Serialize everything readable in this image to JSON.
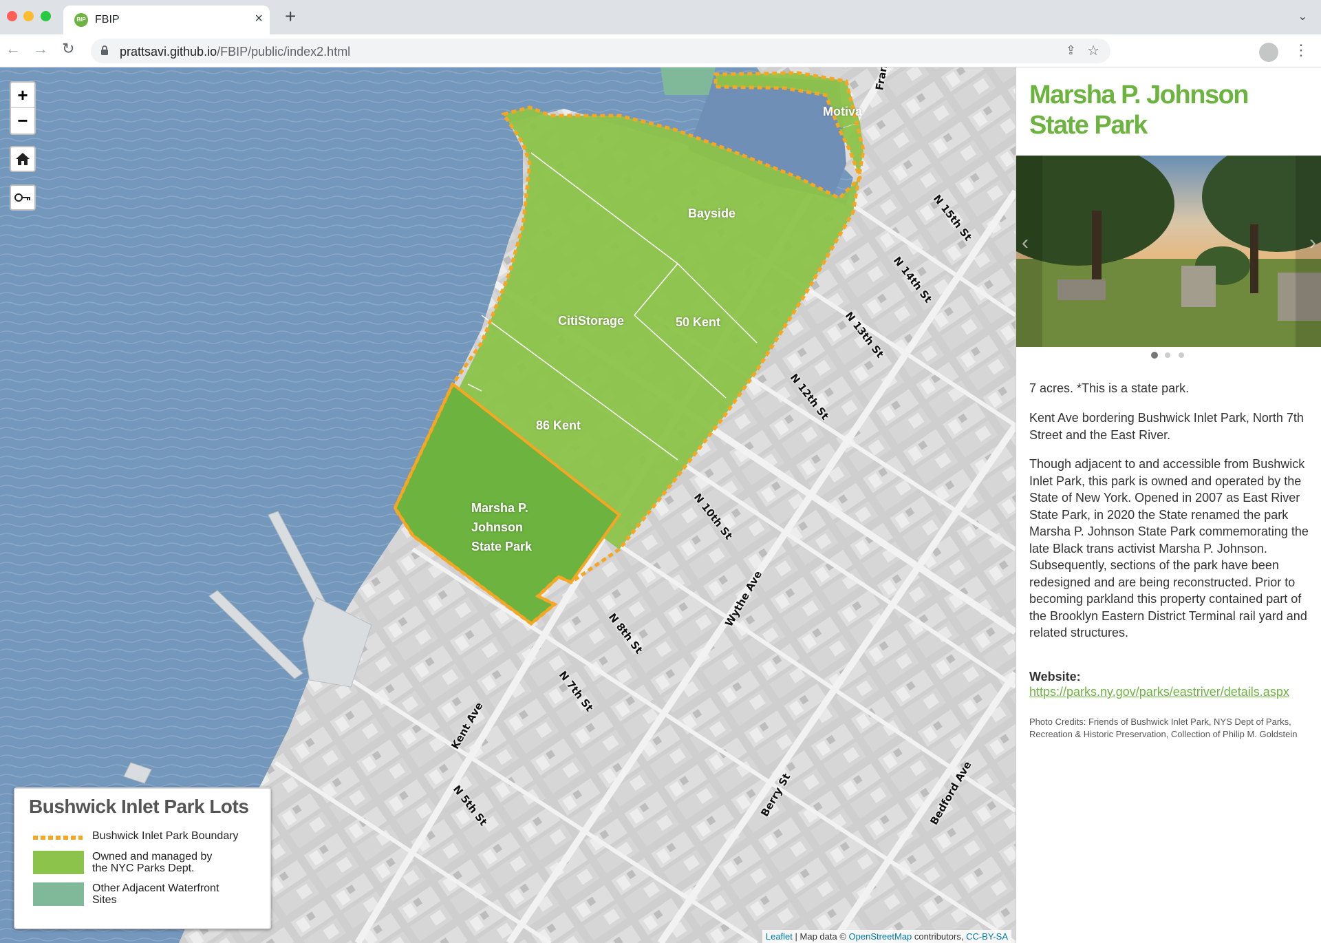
{
  "browser": {
    "tab_title": "FBIP",
    "favicon_text": "BIP",
    "url_host": "prattsavi.github.io",
    "url_path": "/FBIP/public/index2.html"
  },
  "map": {
    "controls": {
      "zoom_in": "+",
      "zoom_out": "−",
      "home_icon": "home-icon",
      "key_icon": "key-icon"
    },
    "lots": {
      "bayside": "Bayside",
      "citistorage": "CitiStorage",
      "fifty_kent": "50 Kent",
      "eighty_six_kent": "86 Kent",
      "mpj_line1": "Marsha P.",
      "mpj_line2": "Johnson",
      "mpj_line3": "State Park",
      "motiva": "Motiva"
    },
    "streets": {
      "fran": "Fran",
      "n15": "N 15th St",
      "n14": "N 14th St",
      "n13": "N 13th St",
      "n12": "N 12th St",
      "n10": "N 10th St",
      "wythe": "Wythe Ave",
      "n8": "N 8th St",
      "n7": "N 7th St",
      "kent": "Kent Ave",
      "n5": "N 5th St",
      "berry": "Berry St",
      "bedford": "Bedford Ave"
    },
    "legend": {
      "title": "Bushwick Inlet Park Lots",
      "boundary": "Bushwick Inlet Park Boundary",
      "owned_line1": "Owned and managed by",
      "owned_line2": "the NYC Parks Dept.",
      "other_line1": "Other Adjacent Waterfront",
      "other_line2": "Sites"
    },
    "attribution": {
      "leaflet": "Leaflet",
      "mid": " | Map data © ",
      "osm": "OpenStreetMap",
      "contributors": " contributors, ",
      "license": "CC-BY-SA"
    },
    "colors": {
      "water": "#6f92b8",
      "park_green": "#8cc34a",
      "park_dark": "#6cb33f",
      "other_sites": "#7fb99a",
      "boundary": "#f5a623"
    }
  },
  "sidebar": {
    "title": "Marsha P. Johnson State Park",
    "photo_prev": "‹",
    "photo_next": "›",
    "acres": "7 acres. *This is a state park.",
    "location": "Kent Ave bordering Bushwick Inlet Park, North 7th Street and the East River.",
    "description": "Though adjacent to and accessible from Bushwick Inlet Park, this park is owned and operated by the State of New York. Opened in 2007 as East River State Park, in 2020 the State renamed the park Marsha P. Johnson State Park commemorating the late Black trans activist Marsha P. Johnson. Subsequently, sections of the park have been redesigned and are being reconstructed. Prior to becoming parkland this property contained part of the Brooklyn Eastern District Terminal rail yard and related structures.",
    "website_label": "Website:",
    "website_url": "https://parks.ny.gov/parks/eastriver/details.aspx",
    "credits": "Photo Credits: Friends of Bushwick Inlet Park, NYS Dept of Parks, Recreation & Historic Preservation, Collection of Philip M. Goldstein"
  }
}
